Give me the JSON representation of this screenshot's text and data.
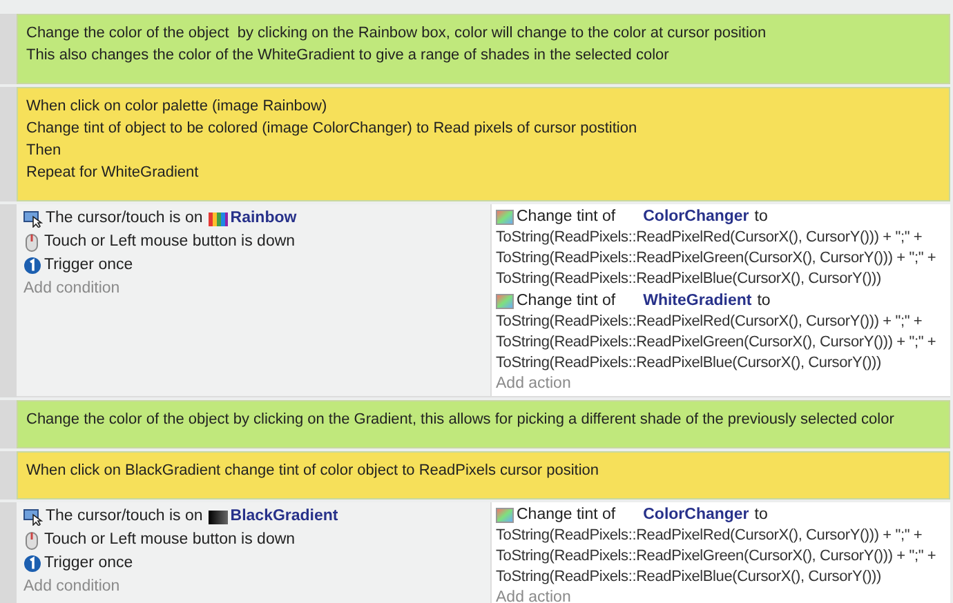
{
  "blocks": [
    {
      "kind": "comment",
      "color": "#c0e87c",
      "lines": [
        "Change the color of the object  by clicking on the Rainbow box, color will change to the color at cursor position",
        "This also changes the color of the WhiteGradient to give a range of shades in the selected color"
      ]
    },
    {
      "kind": "comment",
      "color": "#f6e05a",
      "lines": [
        "When click on color palette (image Rainbow)",
        "Change tint of object to be colored (image ColorChanger) to Read pixels of cursor postition",
        "Then",
        "Repeat for WhiteGradient"
      ]
    },
    {
      "kind": "event",
      "conditions": [
        {
          "kind": "cursor",
          "text": "The cursor/touch is on",
          "object": {
            "name": "Rainbow",
            "kind": "rainbow"
          }
        },
        {
          "kind": "mouse",
          "text": "Touch or Left mouse button is down"
        },
        {
          "kind": "once",
          "text": "Trigger once"
        }
      ],
      "add_condition": "Add condition",
      "actions": [
        {
          "text": "Change tint of",
          "object": "ColorChanger",
          "suffix": "to",
          "expression": [
            "ToString(ReadPixels::ReadPixelRed(CursorX(), CursorY())) + \";\" +",
            "ToString(ReadPixels::ReadPixelGreen(CursorX(), CursorY())) + \";\" +",
            "ToString(ReadPixels::ReadPixelBlue(CursorX(), CursorY()))"
          ]
        },
        {
          "text": "Change tint of",
          "object": "WhiteGradient",
          "suffix": "to",
          "expression": [
            "ToString(ReadPixels::ReadPixelRed(CursorX(), CursorY())) + \";\" +",
            "ToString(ReadPixels::ReadPixelGreen(CursorX(), CursorY())) + \";\" +",
            "ToString(ReadPixels::ReadPixelBlue(CursorX(), CursorY()))"
          ]
        }
      ],
      "add_action": "Add action"
    },
    {
      "kind": "comment",
      "color": "#c0e87c",
      "lines": [
        "Change the color of the object by clicking on the Gradient, this allows for picking a different shade of the previously selected color"
      ]
    },
    {
      "kind": "comment",
      "color": "#f6e05a",
      "lines": [
        "When click on BlackGradient change tint of color object to ReadPixels cursor position"
      ]
    },
    {
      "kind": "event",
      "conditions": [
        {
          "kind": "cursor",
          "text": "The cursor/touch is on",
          "object": {
            "name": "BlackGradient",
            "kind": "gradient"
          }
        },
        {
          "kind": "mouse",
          "text": "Touch or Left mouse button is down"
        },
        {
          "kind": "once",
          "text": "Trigger once"
        }
      ],
      "add_condition": "Add condition",
      "actions": [
        {
          "text": "Change tint of",
          "object": "ColorChanger",
          "suffix": "to",
          "expression": [
            "ToString(ReadPixels::ReadPixelRed(CursorX(), CursorY())) + \";\" +",
            "ToString(ReadPixels::ReadPixelGreen(CursorX(), CursorY())) + \";\" +",
            "ToString(ReadPixels::ReadPixelBlue(CursorX(), CursorY()))"
          ]
        }
      ],
      "add_action": "Add action"
    }
  ]
}
